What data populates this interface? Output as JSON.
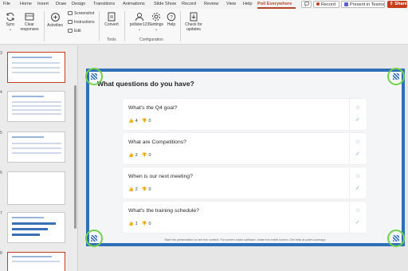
{
  "ribbon_tabs": [
    "File",
    "Home",
    "Insert",
    "Draw",
    "Design",
    "Transitions",
    "Animations",
    "Slide Show",
    "Record",
    "Review",
    "View",
    "Help",
    "Poll Everywhere"
  ],
  "active_tab": "Poll Everywhere",
  "titlebar_buttons": {
    "record": "Record",
    "present": "Present in Teams",
    "share": "Share"
  },
  "ribbon": {
    "sync": "Sync",
    "clear": "Clear responses",
    "activities": "Activities",
    "screenshot": "Screenshot",
    "instructions": "Instructions",
    "edit": "Edit",
    "convert": "Convert",
    "account": "pollster123",
    "settings": "Settings",
    "help": "Help",
    "updates": "Check for updates",
    "group_tools": "Tools",
    "group_configuration": "Configuration"
  },
  "thumbnails": [
    {
      "num": "3",
      "selected": true
    },
    {
      "num": "4"
    },
    {
      "num": "5"
    },
    {
      "num": "6"
    },
    {
      "num": "7"
    },
    {
      "num": "8"
    }
  ],
  "slide": {
    "title": "What questions do you have?",
    "questions": [
      {
        "text": "What's the Q4 goal?",
        "up": "4",
        "down": "0"
      },
      {
        "text": "What are Competitions?",
        "up": "2",
        "down": "0"
      },
      {
        "text": "When is our next meeting?",
        "up": "2",
        "down": "0"
      },
      {
        "text": "What's the training schedule?",
        "up": "1",
        "down": "0"
      }
    ],
    "footer": "Start the presentation to see live content. For screen share software, share the entire screen. Get help at pollev.com/app"
  },
  "colors": {
    "accent": "#c43e1c",
    "slide_border": "#2f6fb8",
    "handle_ring": "#6ed34a"
  }
}
